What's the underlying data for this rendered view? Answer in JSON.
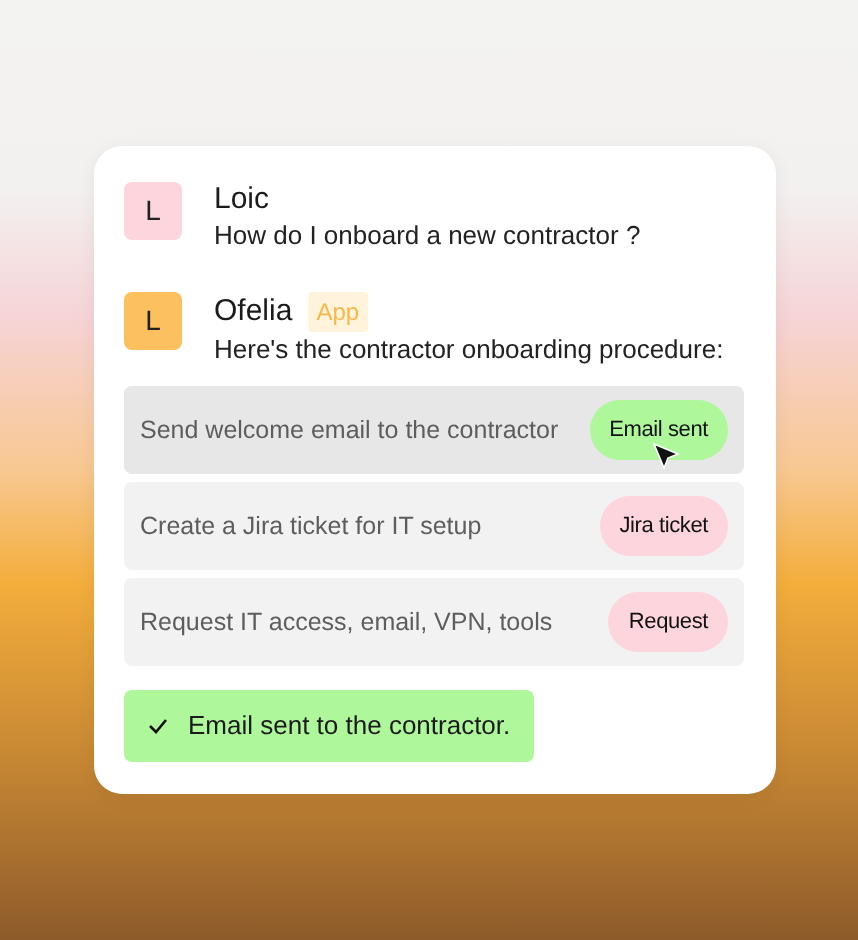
{
  "messages": [
    {
      "avatar": "L",
      "author": "Loic",
      "color": "#fdd5dc",
      "text": "How do I onboard a new contractor ?"
    },
    {
      "avatar": "L",
      "author": "Ofelia",
      "color": "#fcc05e",
      "badge": "App",
      "text": "Here's the contractor onboarding procedure:"
    }
  ],
  "steps": [
    {
      "text": "Send welcome email to the contractor",
      "action": "Email sent",
      "done": true,
      "hovered": true
    },
    {
      "text": "Create a Jira ticket for IT setup",
      "action": "Jira ticket",
      "done": false,
      "hovered": false
    },
    {
      "text": "Request IT access, email, VPN, tools",
      "action": "Request",
      "done": false,
      "hovered": false
    }
  ],
  "toast": {
    "text": "Email sent to the contractor."
  }
}
